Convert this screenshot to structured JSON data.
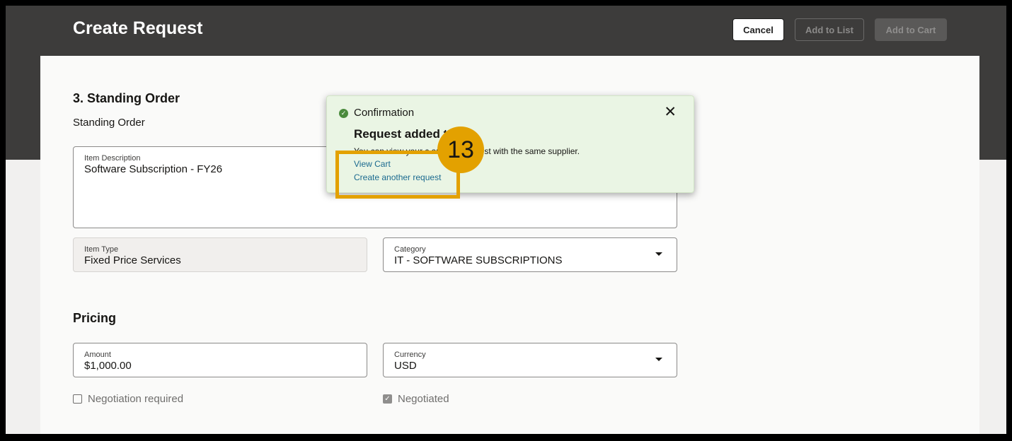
{
  "header": {
    "title": "Create Request",
    "buttons": {
      "cancel": "Cancel",
      "add_to_list": "Add to List",
      "add_to_cart": "Add to Cart"
    }
  },
  "standing_order": {
    "section_title": "3. Standing Order",
    "subtitle": "Standing Order",
    "item_description": {
      "label": "Item Description",
      "value": "Software Subscription - FY26"
    },
    "item_type": {
      "label": "Item Type",
      "value": "Fixed Price Services"
    },
    "category": {
      "label": "Category",
      "value": "IT - SOFTWARE SUBSCRIPTIONS"
    }
  },
  "pricing": {
    "section_title": "Pricing",
    "amount": {
      "label": "Amount",
      "value": "$1,000.00"
    },
    "currency": {
      "label": "Currency",
      "value": "USD"
    },
    "negotiation_required": {
      "label": "Negotiation required",
      "checked": false
    },
    "negotiated": {
      "label": "Negotiated",
      "checked": true
    }
  },
  "toast": {
    "heading": "Confirmation",
    "title": "Request added t",
    "message": "You can view your c                  another request with the same supplier.",
    "links": {
      "view_cart": "View Cart",
      "create_another": "Create another request"
    }
  },
  "callout": {
    "number": "13",
    "color": "#e3a100"
  },
  "icons": {
    "confirm": "check-circle-icon",
    "close": "close-icon",
    "dropdown": "chevron-down-icon"
  }
}
